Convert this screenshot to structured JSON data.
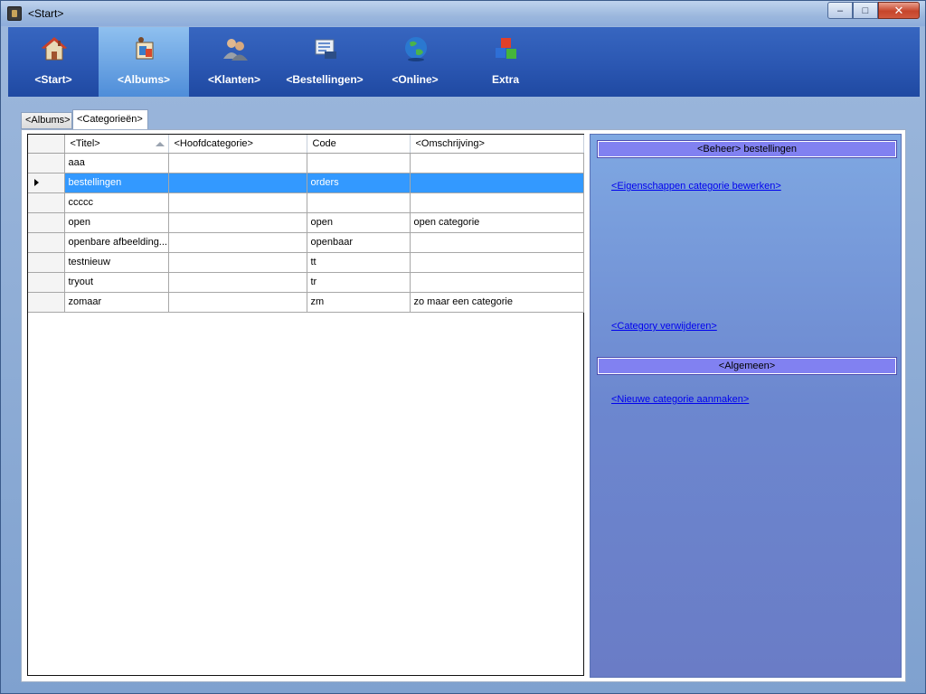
{
  "window": {
    "title": "<Start>",
    "controls": {
      "minimize": "–",
      "maximize": "□",
      "close": "✕"
    }
  },
  "ribbon": {
    "items": [
      {
        "label": "<Start>",
        "icon": "home-icon"
      },
      {
        "label": "<Albums>",
        "icon": "albums-icon",
        "active": true
      },
      {
        "label": "<Klanten>",
        "icon": "customers-icon"
      },
      {
        "label": "<Bestellingen>",
        "icon": "orders-icon"
      },
      {
        "label": "<Online>",
        "icon": "globe-icon"
      },
      {
        "label": "Extra",
        "icon": "blocks-icon"
      }
    ]
  },
  "tabs": [
    {
      "label": "<Albums>"
    },
    {
      "label": "<Categorieën>",
      "active": true
    }
  ],
  "grid": {
    "columns": [
      "<Titel>",
      "<Hoofdcategorie>",
      "Code",
      "<Omschrijving>"
    ],
    "sorted_column": "<Titel>",
    "selected_row": 1,
    "rows": [
      [
        "aaa",
        "",
        "",
        ""
      ],
      [
        "bestellingen",
        "",
        "orders",
        ""
      ],
      [
        "ccccc",
        "",
        "",
        ""
      ],
      [
        "open",
        "",
        "open",
        "open categorie"
      ],
      [
        "openbare afbeelding...",
        "",
        "openbaar",
        ""
      ],
      [
        "testnieuw",
        "",
        "tt",
        ""
      ],
      [
        "tryout",
        "",
        "tr",
        ""
      ],
      [
        "zomaar",
        "",
        "zm",
        "zo maar een categorie"
      ]
    ]
  },
  "side": {
    "header1": "<Beheer> bestellingen",
    "link_edit": "<Eigenschappen categorie bewerken>",
    "link_delete": "<Category verwijderen>",
    "header2": "<Algemeen>",
    "link_new": "<Nieuwe categorie aanmaken>"
  },
  "colors": {
    "ribbon": "#2b57b2",
    "active_ribbon": "#6aa7e8",
    "selection": "#3399ff",
    "panel_header": "#8181f1",
    "link": "#0000ee"
  }
}
